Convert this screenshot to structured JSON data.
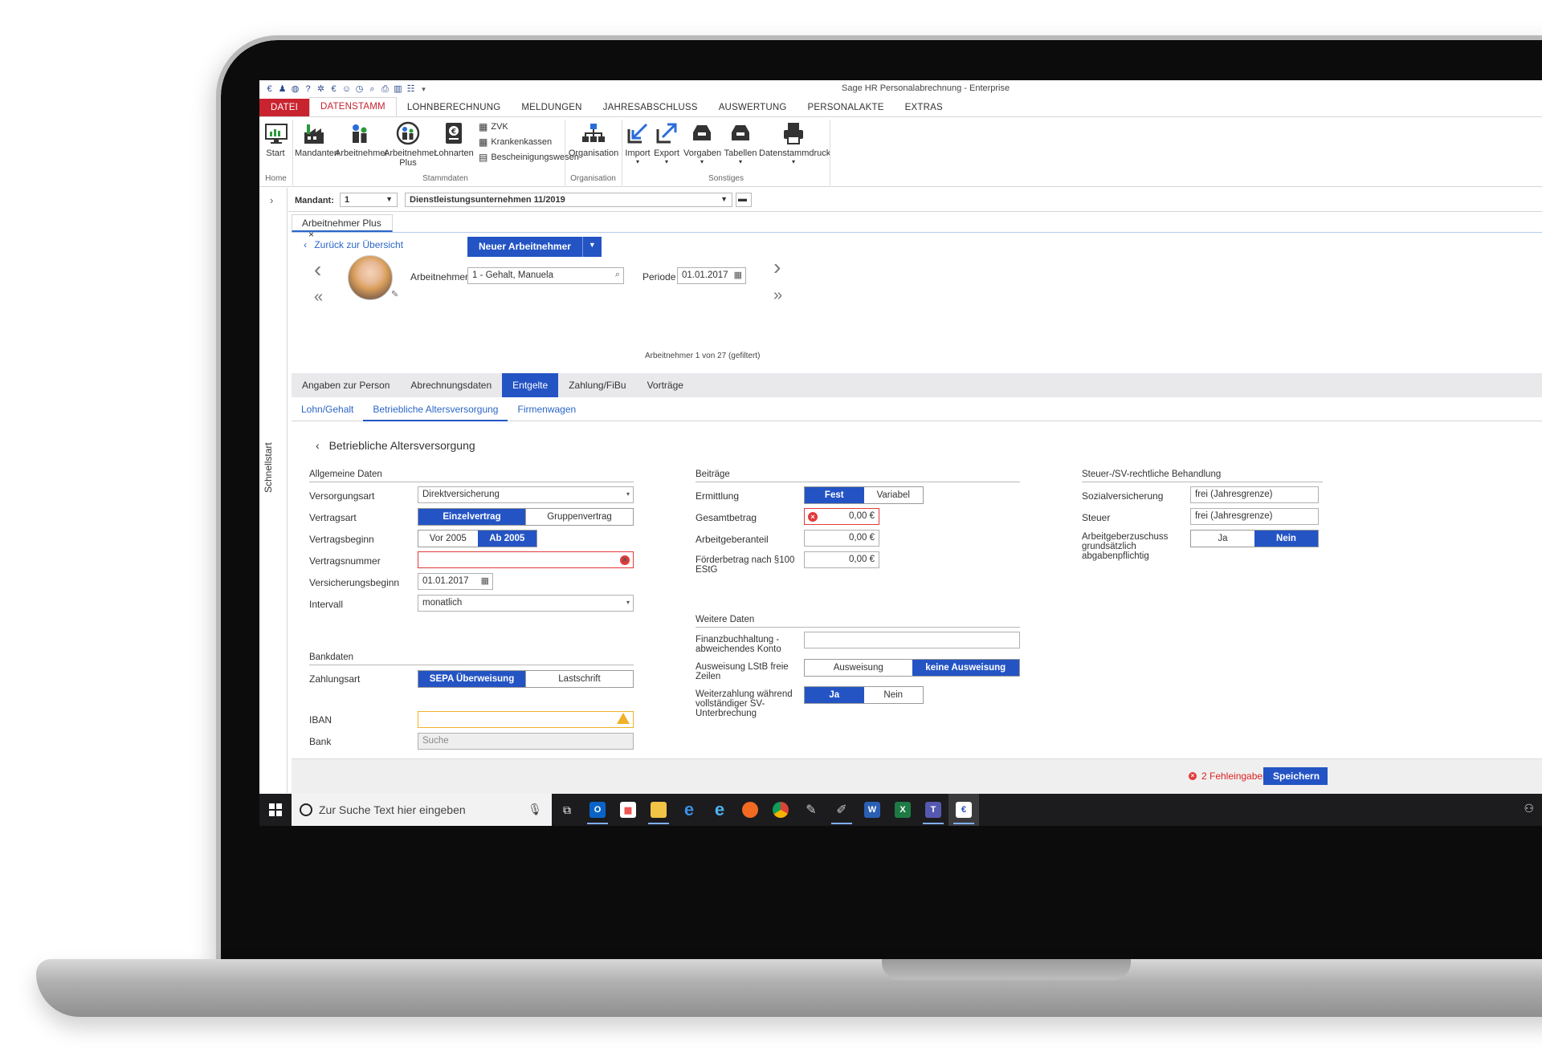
{
  "window": {
    "title": "Sage HR Personalabrechnung - Enterprise"
  },
  "menu": {
    "items": [
      "DATEI",
      "DATENSTAMM",
      "LOHNBERECHNUNG",
      "MELDUNGEN",
      "JAHRESABSCHLUSS",
      "AUSWERTUNG",
      "PERSONALAKTE",
      "EXTRAS"
    ],
    "active": "DATENSTAMM"
  },
  "ribbon": {
    "start": "Start",
    "mandanten": "Mandanten",
    "arbeitnehmer": "Arbeitnehmer",
    "arbeitnehmer_plus_1": "Arbeitnehmer",
    "arbeitnehmer_plus_2": "Plus",
    "lohnarten": "Lohnarten",
    "zvk": "ZVK",
    "krankenkassen": "Krankenkassen",
    "bescheinigungswesen": "Bescheinigungswesen",
    "organisation": "Organisation",
    "import": "Import",
    "export": "Export",
    "vorgaben": "Vorgaben",
    "tabellen": "Tabellen",
    "datenstammdruck": "Datenstammdruck",
    "group_home": "Home",
    "group_stammdaten": "Stammdaten",
    "group_organisation": "Organisation",
    "group_sonstiges": "Sonstiges"
  },
  "sidebar": {
    "label": "Schnellstart"
  },
  "mandant": {
    "label": "Mandant:",
    "number": "1",
    "name": "Dienstleistungsunternehmen 11/2019"
  },
  "doc_tab": {
    "label": "Arbeitnehmer Plus",
    "close": "×"
  },
  "header": {
    "back_link": "Zurück zur Übersicht",
    "new_button": "Neuer Arbeitnehmer",
    "arbeitnehmer_label": "Arbeitnehmer",
    "arbeitnehmer_value": "1 - Gehalt, Manuela",
    "periode_label": "Periode",
    "periode_value": "01.01.2017",
    "count_text": "Arbeitnehmer 1 von 27 (gefiltert)"
  },
  "tabs": [
    "Angaben zur Person",
    "Abrechnungsdaten",
    "Entgelte",
    "Zahlung/FiBu",
    "Vorträge"
  ],
  "active_tab": "Entgelte",
  "subtabs": [
    "Lohn/Gehalt",
    "Betriebliche Altersversorgung",
    "Firmenwagen"
  ],
  "active_subtab": "Betriebliche Altersversorgung",
  "section_title": "Betriebliche Altersversorgung",
  "allgemeine": {
    "title": "Allgemeine Daten",
    "versorgungsart_label": "Versorgungsart",
    "versorgungsart_value": "Direktversicherung",
    "vertragsart_label": "Vertragsart",
    "vertragsart_opt1": "Einzelvertrag",
    "vertragsart_opt2": "Gruppenvertrag",
    "vertragsbeginn_label": "Vertragsbeginn",
    "vertragsbeginn_opt1": "Vor 2005",
    "vertragsbeginn_opt2": "Ab 2005",
    "vertragsnummer_label": "Vertragsnummer",
    "vertragsnummer_value": "",
    "versicherungsbeginn_label": "Versicherungsbeginn",
    "versicherungsbeginn_value": "01.01.2017",
    "intervall_label": "Intervall",
    "intervall_value": "monatlich"
  },
  "bankdaten": {
    "title": "Bankdaten",
    "zahlungsart_label": "Zahlungsart",
    "zahlungsart_opt1": "SEPA Überweisung",
    "zahlungsart_opt2": "Lastschrift",
    "iban_label": "IBAN",
    "iban_value": "",
    "bank_label": "Bank",
    "bank_placeholder": "Suche"
  },
  "beitraege": {
    "title": "Beiträge",
    "ermittlung_label": "Ermittlung",
    "ermittlung_opt1": "Fest",
    "ermittlung_opt2": "Variabel",
    "gesamtbetrag_label": "Gesamtbetrag",
    "gesamtbetrag_value": "0,00 €",
    "arbeitgeberanteil_label": "Arbeitgeberanteil",
    "arbeitgeberanteil_value": "0,00 €",
    "foerderbetrag_label_1": "Förderbetrag nach §100",
    "foerderbetrag_label_2": "EStG",
    "foerderbetrag_value": "0,00 €"
  },
  "weitere": {
    "title": "Weitere Daten",
    "fibu_label_1": "Finanzbuchhaltung -",
    "fibu_label_2": "abweichendes Konto",
    "fibu_value": "",
    "lstb_label_1": "Ausweisung LStB freie",
    "lstb_label_2": "Zeilen",
    "lstb_opt1": "Ausweisung",
    "lstb_opt2": "keine Ausweisung",
    "weiterzahlung_label_1": "Weiterzahlung während",
    "weiterzahlung_label_2": "vollständiger SV-",
    "weiterzahlung_label_3": "Unterbrechung",
    "weiterzahlung_opt1": "Ja",
    "weiterzahlung_opt2": "Nein"
  },
  "steuer": {
    "title": "Steuer-/SV-rechtliche Behandlung",
    "sozial_label": "Sozialversicherung",
    "sozial_value": "frei (Jahresgrenze)",
    "steuer_label": "Steuer",
    "steuer_value": "frei (Jahresgrenze)",
    "zuschuss_label_1": "Arbeitgeberzuschuss",
    "zuschuss_label_2": "grundsätzlich",
    "zuschuss_label_3": "abgabenpflichtig",
    "zuschuss_opt1": "Ja",
    "zuschuss_opt2": "Nein"
  },
  "footer": {
    "errors": "2 Fehleingaben",
    "save": "Speichern"
  },
  "taskbar": {
    "search_placeholder": "Zur Suche Text hier eingeben",
    "apps": [
      "task-view",
      "outlook",
      "store",
      "explorer",
      "edge",
      "ie",
      "firefox",
      "chrome",
      "paint",
      "paint3d",
      "word",
      "excel",
      "teams",
      "sage"
    ]
  },
  "colors": {
    "accent": "#2454c4",
    "error": "#e23a3a",
    "warning": "#f0b12a",
    "file_tab": "#c9232f"
  }
}
